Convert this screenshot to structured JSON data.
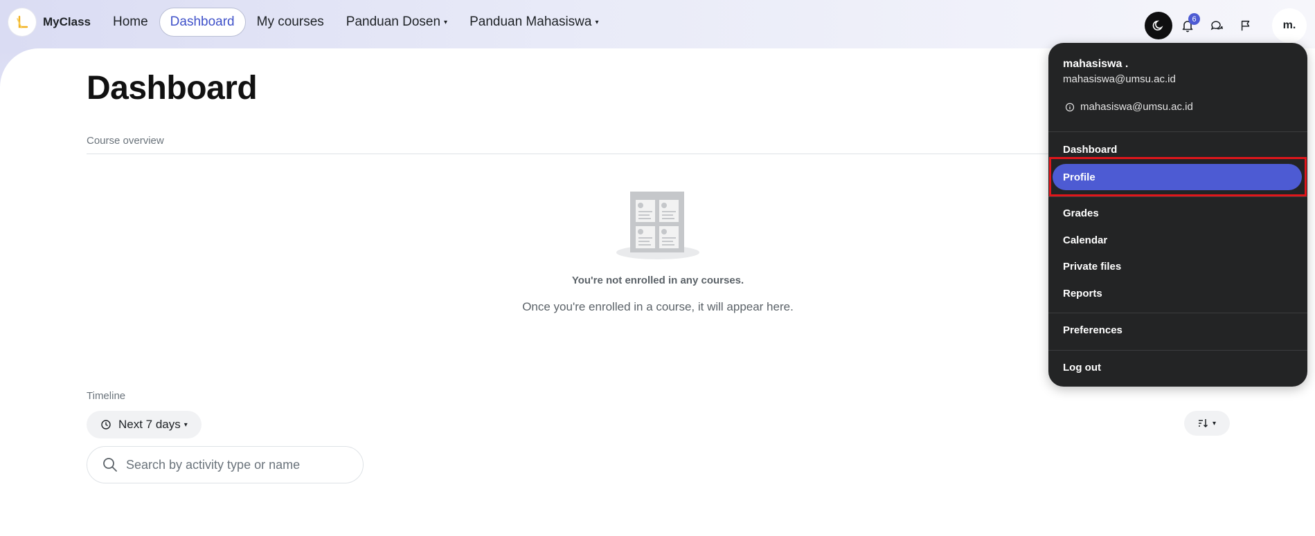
{
  "navbar": {
    "brand": "MyClass",
    "items": [
      {
        "label": "Home",
        "active": false
      },
      {
        "label": "Dashboard",
        "active": true
      },
      {
        "label": "My courses",
        "active": false
      },
      {
        "label": "Panduan Dosen",
        "active": false,
        "dropdown": true
      },
      {
        "label": "Panduan Mahasiswa",
        "active": false,
        "dropdown": true
      }
    ],
    "notifications_count": "6",
    "avatar_initials": "m.",
    "icons": [
      "moon-icon",
      "bell-icon",
      "chat-icon",
      "flag-icon"
    ]
  },
  "main": {
    "title": "Dashboard",
    "course_overview_label": "Course overview",
    "empty_title": "You're not enrolled in any courses.",
    "empty_subtitle": "Once you're enrolled in a course, it will appear here."
  },
  "timeline": {
    "label": "Timeline",
    "filter_label": "Next 7 days",
    "search_placeholder": "Search by activity type or name"
  },
  "user_menu": {
    "name": "mahasiswa .",
    "email": "mahasiswa@umsu.ac.id",
    "info_email": "mahasiswa@umsu.ac.id",
    "items": [
      "Dashboard",
      "Profile",
      "Grades",
      "Calendar",
      "Private files",
      "Reports",
      "Preferences",
      "Log out"
    ],
    "highlighted": "Profile"
  },
  "colors": {
    "accent": "#4d5bd3",
    "active_nav_text": "#3f51c9",
    "menu_bg": "#232425",
    "highlight_border": "#e0161b"
  }
}
